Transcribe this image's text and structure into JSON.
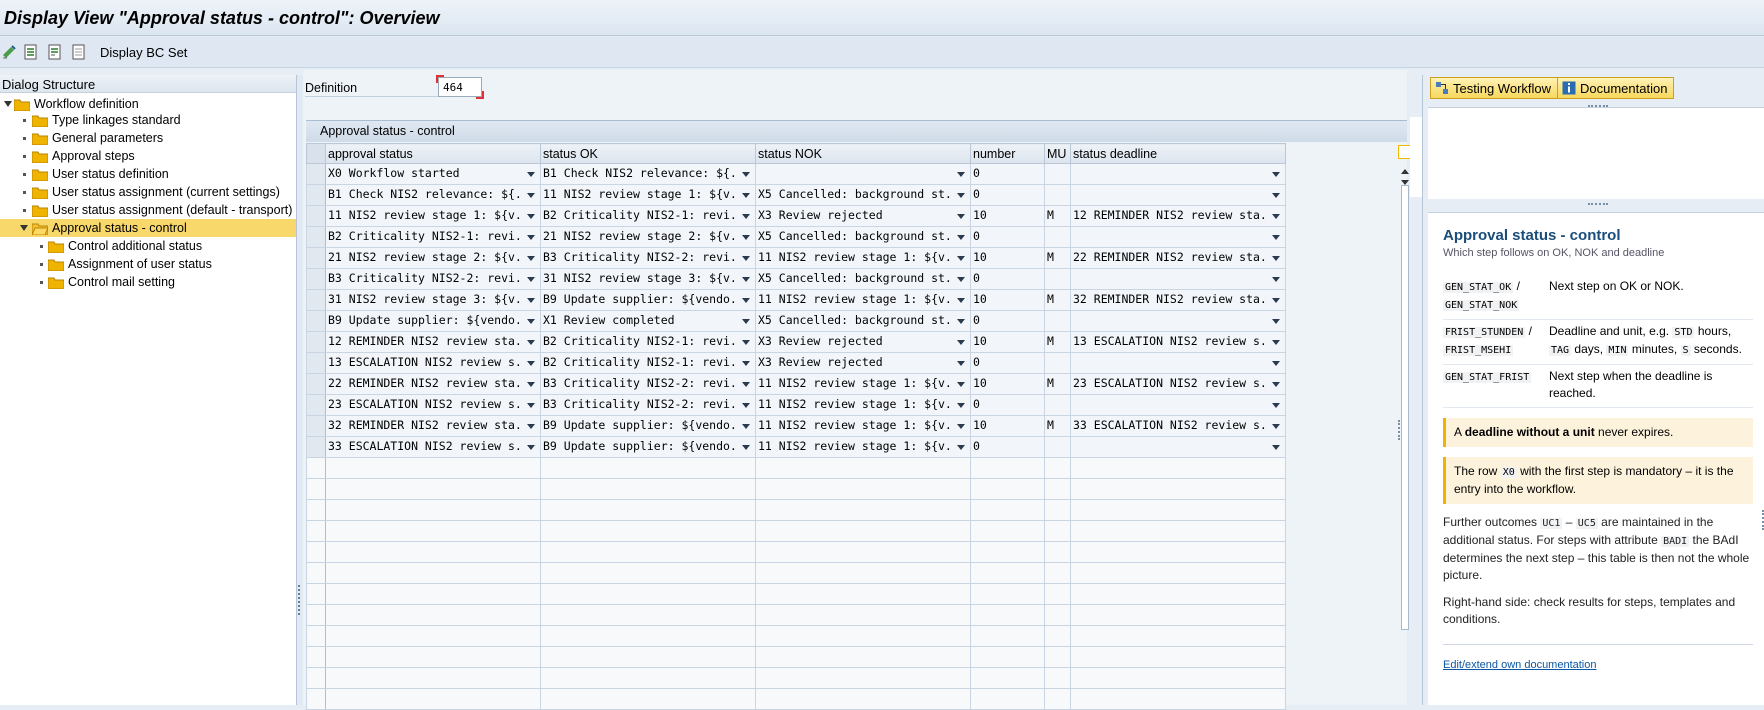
{
  "window": {
    "title": "Display View \"Approval status - control\": Overview"
  },
  "toolbar": {
    "display_bc_set": "Display BC Set"
  },
  "dialog_structure": {
    "header": "Dialog Structure",
    "items": [
      {
        "label": "Workflow definition"
      },
      {
        "label": "Type linkages standard"
      },
      {
        "label": "General parameters"
      },
      {
        "label": "Approval steps"
      },
      {
        "label": "User status definition"
      },
      {
        "label": "User status assignment (current settings)"
      },
      {
        "label": "User status assignment (default - transport)"
      },
      {
        "label": "Approval status - control"
      },
      {
        "label": "Control additional status"
      },
      {
        "label": "Assignment of user status"
      },
      {
        "label": "Control mail setting"
      }
    ]
  },
  "definition": {
    "label": "Definition",
    "value": "464"
  },
  "table": {
    "caption": "Approval status - control",
    "columns": [
      "approval status",
      "status OK",
      "status NOK",
      "number",
      "MU",
      "status deadline"
    ],
    "rows": [
      [
        "X0 Workflow started",
        "B1 Check NIS2 relevance: ${...",
        "",
        "0",
        "",
        ""
      ],
      [
        "B1 Check NIS2 relevance: ${...",
        "11 NIS2 review stage 1: ${v...",
        "X5 Cancelled: background st...",
        "0",
        "",
        ""
      ],
      [
        "11 NIS2 review stage 1: ${v...",
        "B2 Criticality NIS2-1: revi...",
        "X3 Review rejected",
        "10",
        "MIN",
        "12 REMINDER NIS2 review sta..."
      ],
      [
        "B2 Criticality NIS2-1: revi...",
        "21 NIS2 review stage 2: ${v...",
        "X5 Cancelled: background st...",
        "0",
        "",
        ""
      ],
      [
        "21 NIS2 review stage 2: ${v...",
        "B3 Criticality NIS2-2: revi...",
        "11 NIS2 review stage 1: ${v...",
        "10",
        "MIN",
        "22 REMINDER NIS2 review sta..."
      ],
      [
        "B3 Criticality NIS2-2: revi...",
        "31 NIS2 review stage 3: ${v...",
        "X5 Cancelled: background st...",
        "0",
        "",
        ""
      ],
      [
        "31 NIS2 review stage 3: ${v...",
        "B9 Update supplier: ${vendo...",
        "11 NIS2 review stage 1: ${v...",
        "10",
        "MIN",
        "32 REMINDER NIS2 review sta..."
      ],
      [
        "B9 Update supplier: ${vendo...",
        "X1 Review completed",
        "X5 Cancelled: background st...",
        "0",
        "",
        ""
      ],
      [
        "12 REMINDER NIS2 review sta...",
        "B2 Criticality NIS2-1: revi...",
        "X3 Review rejected",
        "10",
        "MIN",
        "13 ESCALATION NIS2 review s..."
      ],
      [
        "13 ESCALATION NIS2 review s...",
        "B2 Criticality NIS2-1: revi...",
        "X3 Review rejected",
        "0",
        "",
        ""
      ],
      [
        "22 REMINDER NIS2 review sta...",
        "B3 Criticality NIS2-2: revi...",
        "11 NIS2 review stage 1: ${v...",
        "10",
        "MIN",
        "23 ESCALATION NIS2 review s..."
      ],
      [
        "23 ESCALATION NIS2 review s...",
        "B3 Criticality NIS2-2: revi...",
        "11 NIS2 review stage 1: ${v...",
        "0",
        "",
        ""
      ],
      [
        "32 REMINDER NIS2 review sta...",
        "B9 Update supplier: ${vendo...",
        "11 NIS2 review stage 1: ${v...",
        "10",
        "MIN",
        "33 ESCALATION NIS2 review s..."
      ],
      [
        "33 ESCALATION NIS2 review s...",
        "B9 Update supplier: ${vendo...",
        "11 NIS2 review stage 1: ${v...",
        "0",
        "",
        ""
      ]
    ]
  },
  "right_panel": {
    "testing_workflow": "Testing Workflow",
    "documentation": "Documentation"
  },
  "doc": {
    "title": "Approval status - control",
    "subtitle": "Which step follows on OK, NOK and deadline",
    "fields": [
      {
        "key1": "GEN_STAT_OK",
        "sep": " /",
        "key2": "GEN_STAT_NOK",
        "desc": "Next step on OK or NOK."
      },
      {
        "key1": "FRIST_STUNDEN",
        "sep": " /",
        "key2": "FRIST_MSEHI",
        "desc_pre": "Deadline and unit, e.g. ",
        "c1": "STD",
        "t1": " hours, ",
        "c2": "TAG",
        "t2": " days, ",
        "c3": "MIN",
        "t3": " minutes, ",
        "c4": "S",
        "t4": " seconds."
      },
      {
        "key1": "GEN_STAT_FRIST",
        "desc": "Next step when the deadline is reached."
      }
    ],
    "note1_pre": "A ",
    "note1_bold": "deadline without a unit",
    "note1_post": " never expires.",
    "note2_pre": "The row ",
    "note2_code": "X0",
    "note2_post": " with the first step is mandatory – it is the entry into the workflow.",
    "para1_a": "Further outcomes ",
    "para1_c1": "UC1",
    "para1_b": " – ",
    "para1_c2": "UC5",
    "para1_c": " are maintained in the additional status. For steps with attribute ",
    "para1_c3": "BADI",
    "para1_d": " the BAdI determines the next step – this table is then not the whole picture.",
    "para2": "Right-hand side: check results for steps, templates and conditions.",
    "link": "Edit/extend own documentation"
  },
  "colors": {
    "selection": "#f8d86b",
    "button_yellow": "#f7d75c",
    "doc_title": "#1a4d7a",
    "link": "#0a57a4"
  }
}
